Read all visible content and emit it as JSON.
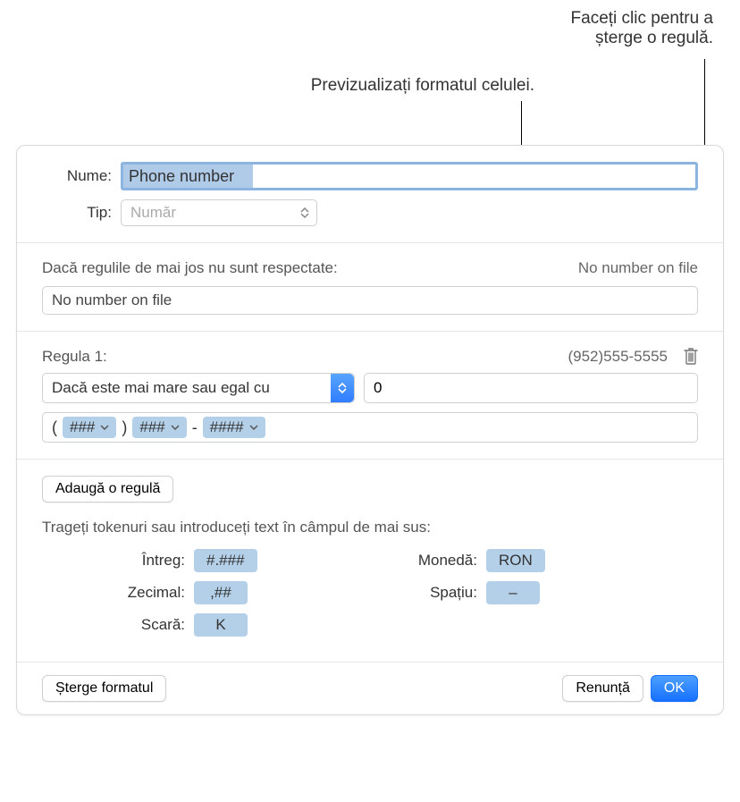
{
  "annotations": {
    "delete_rule": "Faceți clic pentru a\nșterge o regulă.",
    "preview_format": "Previzualizați formatul celulei."
  },
  "header": {
    "name_label": "Nume:",
    "name_value": "Phone number",
    "type_label": "Tip:",
    "type_value": "Număr"
  },
  "else_section": {
    "heading": "Dacă regulile de mai jos nu sunt respectate:",
    "preview": "No number on file",
    "value": "No number on file"
  },
  "rule1": {
    "label": "Regula 1:",
    "preview": "(952)555-5555",
    "condition": "Dacă este mai mare sau egal cu",
    "condition_value": "0",
    "format": {
      "open": "(",
      "t1": "###",
      "close": ")",
      "t2": "###",
      "dash": "-",
      "t3": "####"
    }
  },
  "add_rule_button": "Adaugă o regulă",
  "tokens_hint": "Trageți tokenuri sau introduceți text în câmpul de mai sus:",
  "tokens": {
    "integer_label": "Întreg:",
    "integer_value": "#.###",
    "decimal_label": "Zecimal:",
    "decimal_value": ",##",
    "scale_label": "Scară:",
    "scale_value": "K",
    "currency_label": "Monedă:",
    "currency_value": "RON",
    "space_label": "Spațiu:",
    "space_value": "–"
  },
  "footer": {
    "delete_format": "Șterge formatul",
    "cancel": "Renunță",
    "ok": "OK"
  }
}
